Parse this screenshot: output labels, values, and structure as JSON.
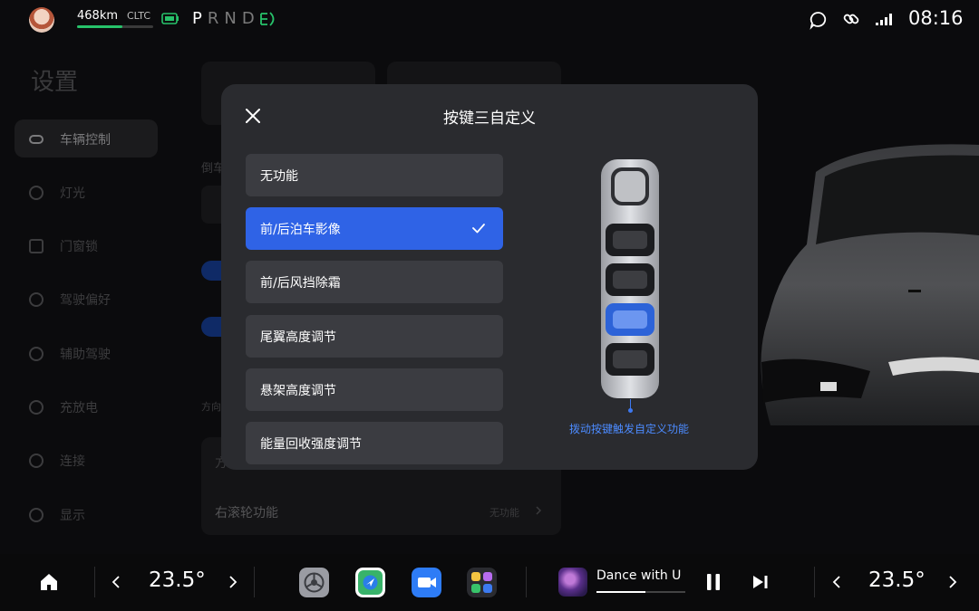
{
  "status": {
    "range": "468km",
    "cycle": "CLTC",
    "range_fraction": 0.6,
    "gear_selected": "P",
    "gears_rest": "RND",
    "time": "08:16"
  },
  "sidebar": {
    "title": "设置",
    "items": [
      {
        "label": "车辆控制",
        "icon": "car-control-icon"
      },
      {
        "label": "灯光",
        "icon": "light-icon"
      },
      {
        "label": "门窗锁",
        "icon": "door-lock-icon"
      },
      {
        "label": "驾驶偏好",
        "icon": "steering-wheel-icon"
      },
      {
        "label": "辅助驾驶",
        "icon": "assist-drive-icon"
      },
      {
        "label": "充放电",
        "icon": "charge-icon"
      },
      {
        "label": "连接",
        "icon": "connect-icon"
      },
      {
        "label": "显示",
        "icon": "display-icon"
      }
    ]
  },
  "background_panel": {
    "label_reverse": "倒车",
    "label_direction": "方向",
    "label_fa": "方",
    "row_label": "右滚轮功能",
    "row_value": "无功能"
  },
  "modal": {
    "title": "按键三自定义",
    "options": [
      {
        "label": "无功能",
        "selected": false
      },
      {
        "label": "前/后泊车影像",
        "selected": true
      },
      {
        "label": "前/后风挡除霜",
        "selected": false
      },
      {
        "label": "尾翼高度调节",
        "selected": false
      },
      {
        "label": "悬架高度调节",
        "selected": false
      },
      {
        "label": "能量回收强度调节",
        "selected": false
      }
    ],
    "hint": "拨动按键触发自定义功能",
    "accent": "#2f63e6"
  },
  "dock": {
    "temp_left": "23.5°",
    "temp_right": "23.5°",
    "apps": [
      "settings-app-icon",
      "navigation-app-icon",
      "video-call-app-icon",
      "apps-grid-icon"
    ],
    "song": "Dance with U",
    "song_progress": 0.55
  }
}
